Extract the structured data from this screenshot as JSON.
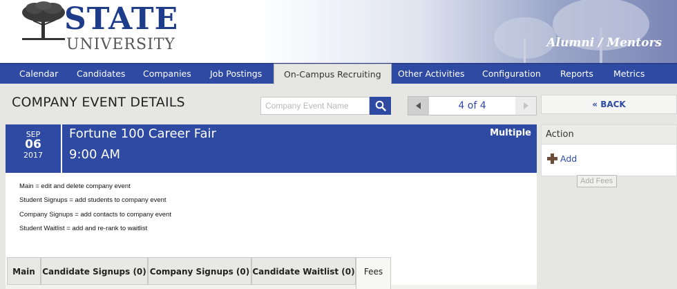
{
  "header": {
    "logo_main": "STATE",
    "logo_sub": "UNIVERSITY",
    "tagline": "Alumni / Mentors"
  },
  "nav": {
    "items": [
      {
        "label": "Calendar"
      },
      {
        "label": "Candidates"
      },
      {
        "label": "Companies"
      },
      {
        "label": "Job Postings"
      },
      {
        "label": "On-Campus Recruiting",
        "active": true
      },
      {
        "label": "Other Activities"
      },
      {
        "label": "Configuration"
      },
      {
        "label": "Reports"
      },
      {
        "label": "Metrics"
      }
    ]
  },
  "page": {
    "title": "COMPANY EVENT DETAILS"
  },
  "search": {
    "placeholder": "Company Event Name",
    "icon": "search-icon"
  },
  "pager": {
    "text": "4 of 4",
    "prev_icon": "triangle-left-icon",
    "next_icon": "triangle-right-icon"
  },
  "back": {
    "label": "« BACK"
  },
  "event": {
    "month": "SEP",
    "day": "06",
    "year": "2017",
    "title": "Fortune 100 Career Fair",
    "time": "9:00 AM",
    "badge": "Multiple"
  },
  "description": {
    "lines": [
      "Main = edit and delete company event",
      "Student Signups = add students to company event",
      "Company Signups = add contacts to company event",
      "Student Waitlist = add and re-rank to waitlist"
    ]
  },
  "tabs": [
    {
      "label": "Main"
    },
    {
      "label": "Candidate Signups (0)"
    },
    {
      "label": "Company Signups (0)"
    },
    {
      "label": "Candidate Waitlist (0)"
    },
    {
      "label": "Fees",
      "active": true
    }
  ],
  "action": {
    "title": "Action",
    "add_label": "Add",
    "add_icon": "plus-icon",
    "tooltip": "Add Fees"
  },
  "colors": {
    "brand_blue": "#2e4aa3",
    "background": "#e6e6e3"
  }
}
